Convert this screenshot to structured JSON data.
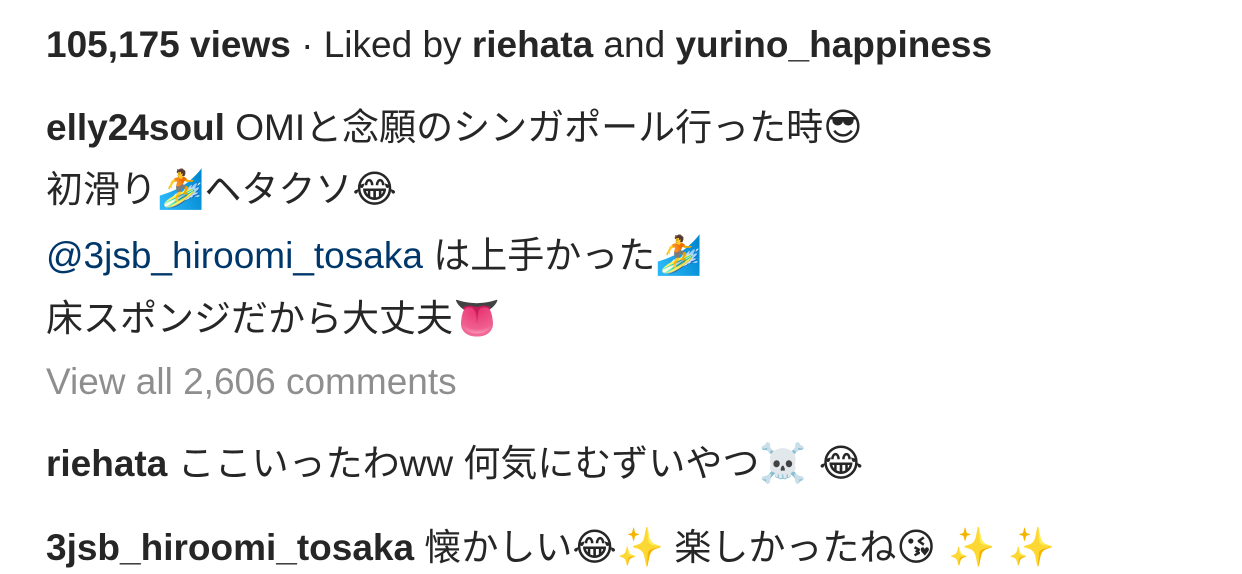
{
  "stats": {
    "views": "105,175 views",
    "separator": " · ",
    "liked_by_prefix": "Liked by ",
    "liker1": "riehata",
    "and": " and ",
    "liker2": "yurino_happiness"
  },
  "caption": {
    "username": "elly24soul",
    "line1": " OMIと念願のシンガポール行った時",
    "line1_emoji": "😎",
    "line2_a": "初滑り",
    "line2_emoji1": "🏄",
    "line2_b": "ヘタクソ",
    "line2_emoji2": "😂",
    "line3_mention": "@3jsb_hiroomi_tosaka",
    "line3_text": " は上手かった",
    "line3_emoji": "🏄",
    "line4_text": "床スポンジだから大丈夫",
    "line4_emoji": "👅"
  },
  "view_all": "View all 2,606 comments",
  "comments": [
    {
      "username": "riehata",
      "text": " ここいったわww 何気にむずいやつ",
      "emoji1": "☠️",
      "emoji2": " 😂"
    },
    {
      "username": "3jsb_hiroomi_tosaka",
      "text_a": " 懐かしい",
      "emoji1": "😂",
      "emoji2": "✨",
      "text_b": " 楽しかったね",
      "emoji3": "😘",
      "emoji4": " ✨",
      "emoji5": " ✨"
    }
  ]
}
